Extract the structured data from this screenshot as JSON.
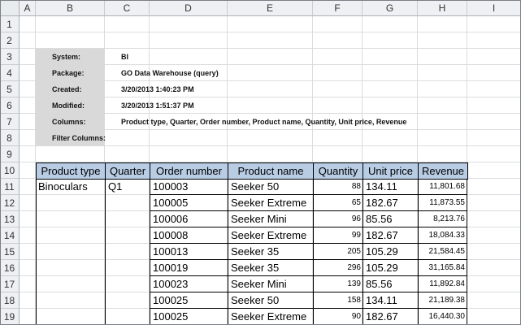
{
  "columns": [
    "A",
    "B",
    "C",
    "D",
    "E",
    "F",
    "G",
    "H",
    "I"
  ],
  "rows": [
    "1",
    "2",
    "3",
    "4",
    "5",
    "6",
    "7",
    "8",
    "9",
    "10",
    "11",
    "12",
    "13",
    "14",
    "15",
    "16",
    "17",
    "18",
    "19"
  ],
  "meta": [
    {
      "label": "System:",
      "value": "BI"
    },
    {
      "label": "Package:",
      "value": "GO Data Warehouse (query)"
    },
    {
      "label": "Created:",
      "value": "3/20/2013 1:40:23 PM"
    },
    {
      "label": "Modified:",
      "value": "3/20/2013 1:51:37 PM"
    },
    {
      "label": "Columns:",
      "value": "Product type, Quarter, Order number, Product name, Quantity, Unit price, Revenue"
    },
    {
      "label": "Filter Columns:",
      "value": ""
    }
  ],
  "table": {
    "headers": [
      "Product type",
      "Quarter",
      "Order number",
      "Product name",
      "Quantity",
      "Unit price",
      "Revenue"
    ],
    "product_type": "Binoculars",
    "quarter": "Q1",
    "rows": [
      {
        "order": "100003",
        "product": "Seeker 50",
        "qty": "88",
        "price": "134.11",
        "revenue": "11,801.68"
      },
      {
        "order": "100005",
        "product": "Seeker Extreme",
        "qty": "65",
        "price": "182.67",
        "revenue": "11,873.55"
      },
      {
        "order": "100006",
        "product": "Seeker Mini",
        "qty": "96",
        "price": "85.56",
        "revenue": "8,213.76"
      },
      {
        "order": "100008",
        "product": "Seeker Extreme",
        "qty": "99",
        "price": "182.67",
        "revenue": "18,084.33"
      },
      {
        "order": "100013",
        "product": "Seeker 35",
        "qty": "205",
        "price": "105.29",
        "revenue": "21,584.45"
      },
      {
        "order": "100019",
        "product": "Seeker 35",
        "qty": "296",
        "price": "105.29",
        "revenue": "31,165.84"
      },
      {
        "order": "100023",
        "product": "Seeker Mini",
        "qty": "139",
        "price": "85.56",
        "revenue": "11,892.84"
      },
      {
        "order": "100025",
        "product": "Seeker 50",
        "qty": "158",
        "price": "134.11",
        "revenue": "21,189.38"
      },
      {
        "order": "100025",
        "product": "Seeker Extreme",
        "qty": "90",
        "price": "182.67",
        "revenue": "16,440.30"
      }
    ]
  }
}
